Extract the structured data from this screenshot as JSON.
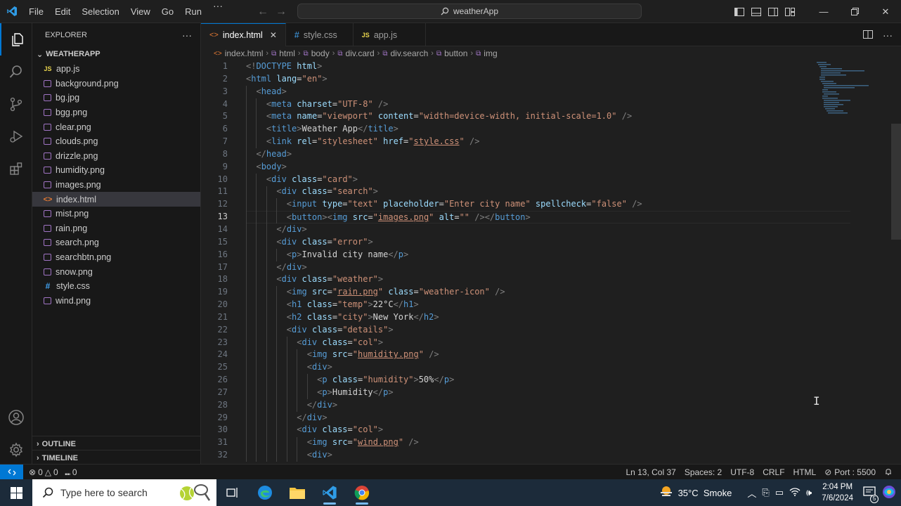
{
  "titlebar": {
    "menu": [
      "File",
      "Edit",
      "Selection",
      "View",
      "Go",
      "Run"
    ],
    "more": "···",
    "command_center": "weatherApp"
  },
  "sidebar": {
    "title": "EXPLORER",
    "more": "···",
    "folder": "WEATHERAPP",
    "files": [
      {
        "name": "app.js",
        "type": "js"
      },
      {
        "name": "background.png",
        "type": "img"
      },
      {
        "name": "bg.jpg",
        "type": "img"
      },
      {
        "name": "bgg.png",
        "type": "img"
      },
      {
        "name": "clear.png",
        "type": "img"
      },
      {
        "name": "clouds.png",
        "type": "img"
      },
      {
        "name": "drizzle.png",
        "type": "img"
      },
      {
        "name": "humidity.png",
        "type": "img"
      },
      {
        "name": "images.png",
        "type": "img"
      },
      {
        "name": "index.html",
        "type": "html",
        "selected": true
      },
      {
        "name": "mist.png",
        "type": "img"
      },
      {
        "name": "rain.png",
        "type": "img"
      },
      {
        "name": "search.png",
        "type": "img"
      },
      {
        "name": "searchbtn.png",
        "type": "img"
      },
      {
        "name": "snow.png",
        "type": "img"
      },
      {
        "name": "style.css",
        "type": "css"
      },
      {
        "name": "wind.png",
        "type": "img"
      }
    ],
    "outline": "OUTLINE",
    "timeline": "TIMELINE"
  },
  "tabs": [
    {
      "label": "index.html",
      "icon": "<>",
      "active": true
    },
    {
      "label": "style.css",
      "icon": "#"
    },
    {
      "label": "app.js",
      "icon": "JS"
    }
  ],
  "breadcrumbs": [
    "index.html",
    "html",
    "body",
    "div.card",
    "div.search",
    "button",
    "img"
  ],
  "editor": {
    "current_line": 13,
    "lines": [
      [
        [
          "t",
          "<!"
        ],
        [
          "tg",
          "DOCTYPE"
        ],
        [
          "tx",
          " "
        ],
        [
          "at",
          "html"
        ],
        [
          "t",
          ">"
        ]
      ],
      [
        [
          "t",
          "<"
        ],
        [
          "tg",
          "html"
        ],
        [
          "tx",
          " "
        ],
        [
          "at",
          "lang"
        ],
        [
          "tx",
          "="
        ],
        [
          "st",
          "\"en\""
        ],
        [
          "t",
          ">"
        ]
      ],
      [
        [
          "tx",
          "  "
        ],
        [
          "t",
          "<"
        ],
        [
          "tg",
          "head"
        ],
        [
          "t",
          ">"
        ]
      ],
      [
        [
          "tx",
          "    "
        ],
        [
          "t",
          "<"
        ],
        [
          "tg",
          "meta"
        ],
        [
          "tx",
          " "
        ],
        [
          "at",
          "charset"
        ],
        [
          "tx",
          "="
        ],
        [
          "st",
          "\"UTF-8\""
        ],
        [
          "tx",
          " "
        ],
        [
          "t",
          "/>"
        ]
      ],
      [
        [
          "tx",
          "    "
        ],
        [
          "t",
          "<"
        ],
        [
          "tg",
          "meta"
        ],
        [
          "tx",
          " "
        ],
        [
          "at",
          "name"
        ],
        [
          "tx",
          "="
        ],
        [
          "st",
          "\"viewport\""
        ],
        [
          "tx",
          " "
        ],
        [
          "at",
          "content"
        ],
        [
          "tx",
          "="
        ],
        [
          "st",
          "\"width=device-width, initial-scale=1.0\""
        ],
        [
          "tx",
          " "
        ],
        [
          "t",
          "/>"
        ]
      ],
      [
        [
          "tx",
          "    "
        ],
        [
          "t",
          "<"
        ],
        [
          "tg",
          "title"
        ],
        [
          "t",
          ">"
        ],
        [
          "tx",
          "Weather App"
        ],
        [
          "t",
          "</"
        ],
        [
          "tg",
          "title"
        ],
        [
          "t",
          ">"
        ]
      ],
      [
        [
          "tx",
          "    "
        ],
        [
          "t",
          "<"
        ],
        [
          "tg",
          "link"
        ],
        [
          "tx",
          " "
        ],
        [
          "at",
          "rel"
        ],
        [
          "tx",
          "="
        ],
        [
          "st",
          "\"stylesheet\""
        ],
        [
          "tx",
          " "
        ],
        [
          "at",
          "href"
        ],
        [
          "tx",
          "="
        ],
        [
          "st",
          "\""
        ],
        [
          "stu",
          "style.css"
        ],
        [
          "st",
          "\""
        ],
        [
          "tx",
          " "
        ],
        [
          "t",
          "/>"
        ]
      ],
      [
        [
          "tx",
          "  "
        ],
        [
          "t",
          "</"
        ],
        [
          "tg",
          "head"
        ],
        [
          "t",
          ">"
        ]
      ],
      [
        [
          "tx",
          "  "
        ],
        [
          "t",
          "<"
        ],
        [
          "tg",
          "body"
        ],
        [
          "t",
          ">"
        ]
      ],
      [
        [
          "tx",
          "    "
        ],
        [
          "t",
          "<"
        ],
        [
          "tg",
          "div"
        ],
        [
          "tx",
          " "
        ],
        [
          "at",
          "class"
        ],
        [
          "tx",
          "="
        ],
        [
          "st",
          "\"card\""
        ],
        [
          "t",
          ">"
        ]
      ],
      [
        [
          "tx",
          "      "
        ],
        [
          "t",
          "<"
        ],
        [
          "tg",
          "div"
        ],
        [
          "tx",
          " "
        ],
        [
          "at",
          "class"
        ],
        [
          "tx",
          "="
        ],
        [
          "st",
          "\"search\""
        ],
        [
          "t",
          ">"
        ]
      ],
      [
        [
          "tx",
          "        "
        ],
        [
          "t",
          "<"
        ],
        [
          "tg",
          "input"
        ],
        [
          "tx",
          " "
        ],
        [
          "at",
          "type"
        ],
        [
          "tx",
          "="
        ],
        [
          "st",
          "\"text\""
        ],
        [
          "tx",
          " "
        ],
        [
          "at",
          "placeholder"
        ],
        [
          "tx",
          "="
        ],
        [
          "st",
          "\"Enter city name\""
        ],
        [
          "tx",
          " "
        ],
        [
          "at",
          "spellcheck"
        ],
        [
          "tx",
          "="
        ],
        [
          "st",
          "\"false\""
        ],
        [
          "tx",
          " "
        ],
        [
          "t",
          "/>"
        ]
      ],
      [
        [
          "tx",
          "        "
        ],
        [
          "t",
          "<"
        ],
        [
          "tg",
          "button"
        ],
        [
          "t",
          "><"
        ],
        [
          "tg",
          "img"
        ],
        [
          "tx",
          " "
        ],
        [
          "at",
          "src"
        ],
        [
          "tx",
          "="
        ],
        [
          "st",
          "\""
        ],
        [
          "stu",
          "images.png"
        ],
        [
          "st",
          "\""
        ],
        [
          "tx",
          " "
        ],
        [
          "at",
          "alt"
        ],
        [
          "tx",
          "="
        ],
        [
          "st",
          "\"\""
        ],
        [
          "tx",
          " "
        ],
        [
          "t",
          "/></"
        ],
        [
          "tg",
          "button"
        ],
        [
          "t",
          ">"
        ]
      ],
      [
        [
          "tx",
          "      "
        ],
        [
          "t",
          "</"
        ],
        [
          "tg",
          "div"
        ],
        [
          "t",
          ">"
        ]
      ],
      [
        [
          "tx",
          "      "
        ],
        [
          "t",
          "<"
        ],
        [
          "tg",
          "div"
        ],
        [
          "tx",
          " "
        ],
        [
          "at",
          "class"
        ],
        [
          "tx",
          "="
        ],
        [
          "st",
          "\"error\""
        ],
        [
          "t",
          ">"
        ]
      ],
      [
        [
          "tx",
          "        "
        ],
        [
          "t",
          "<"
        ],
        [
          "tg",
          "p"
        ],
        [
          "t",
          ">"
        ],
        [
          "tx",
          "Invalid city name"
        ],
        [
          "t",
          "</"
        ],
        [
          "tg",
          "p"
        ],
        [
          "t",
          ">"
        ]
      ],
      [
        [
          "tx",
          "      "
        ],
        [
          "t",
          "</"
        ],
        [
          "tg",
          "div"
        ],
        [
          "t",
          ">"
        ]
      ],
      [
        [
          "tx",
          "      "
        ],
        [
          "t",
          "<"
        ],
        [
          "tg",
          "div"
        ],
        [
          "tx",
          " "
        ],
        [
          "at",
          "class"
        ],
        [
          "tx",
          "="
        ],
        [
          "st",
          "\"weather\""
        ],
        [
          "t",
          ">"
        ]
      ],
      [
        [
          "tx",
          "        "
        ],
        [
          "t",
          "<"
        ],
        [
          "tg",
          "img"
        ],
        [
          "tx",
          " "
        ],
        [
          "at",
          "src"
        ],
        [
          "tx",
          "="
        ],
        [
          "st",
          "\""
        ],
        [
          "stu",
          "rain.png"
        ],
        [
          "st",
          "\""
        ],
        [
          "tx",
          " "
        ],
        [
          "at",
          "class"
        ],
        [
          "tx",
          "="
        ],
        [
          "st",
          "\"weather-icon\""
        ],
        [
          "tx",
          " "
        ],
        [
          "t",
          "/>"
        ]
      ],
      [
        [
          "tx",
          "        "
        ],
        [
          "t",
          "<"
        ],
        [
          "tg",
          "h1"
        ],
        [
          "tx",
          " "
        ],
        [
          "at",
          "class"
        ],
        [
          "tx",
          "="
        ],
        [
          "st",
          "\"temp\""
        ],
        [
          "t",
          ">"
        ],
        [
          "tx",
          "22°C"
        ],
        [
          "t",
          "</"
        ],
        [
          "tg",
          "h1"
        ],
        [
          "t",
          ">"
        ]
      ],
      [
        [
          "tx",
          "        "
        ],
        [
          "t",
          "<"
        ],
        [
          "tg",
          "h2"
        ],
        [
          "tx",
          " "
        ],
        [
          "at",
          "class"
        ],
        [
          "tx",
          "="
        ],
        [
          "st",
          "\"city\""
        ],
        [
          "t",
          ">"
        ],
        [
          "tx",
          "New York"
        ],
        [
          "t",
          "</"
        ],
        [
          "tg",
          "h2"
        ],
        [
          "t",
          ">"
        ]
      ],
      [
        [
          "tx",
          "        "
        ],
        [
          "t",
          "<"
        ],
        [
          "tg",
          "div"
        ],
        [
          "tx",
          " "
        ],
        [
          "at",
          "class"
        ],
        [
          "tx",
          "="
        ],
        [
          "st",
          "\"details\""
        ],
        [
          "t",
          ">"
        ]
      ],
      [
        [
          "tx",
          "          "
        ],
        [
          "t",
          "<"
        ],
        [
          "tg",
          "div"
        ],
        [
          "tx",
          " "
        ],
        [
          "at",
          "class"
        ],
        [
          "tx",
          "="
        ],
        [
          "st",
          "\"col\""
        ],
        [
          "t",
          ">"
        ]
      ],
      [
        [
          "tx",
          "            "
        ],
        [
          "t",
          "<"
        ],
        [
          "tg",
          "img"
        ],
        [
          "tx",
          " "
        ],
        [
          "at",
          "src"
        ],
        [
          "tx",
          "="
        ],
        [
          "st",
          "\""
        ],
        [
          "stu",
          "humidity.png"
        ],
        [
          "st",
          "\""
        ],
        [
          "tx",
          " "
        ],
        [
          "t",
          "/>"
        ]
      ],
      [
        [
          "tx",
          "            "
        ],
        [
          "t",
          "<"
        ],
        [
          "tg",
          "div"
        ],
        [
          "t",
          ">"
        ]
      ],
      [
        [
          "tx",
          "              "
        ],
        [
          "t",
          "<"
        ],
        [
          "tg",
          "p"
        ],
        [
          "tx",
          " "
        ],
        [
          "at",
          "class"
        ],
        [
          "tx",
          "="
        ],
        [
          "st",
          "\"humidity\""
        ],
        [
          "t",
          ">"
        ],
        [
          "tx",
          "50%"
        ],
        [
          "t",
          "</"
        ],
        [
          "tg",
          "p"
        ],
        [
          "t",
          ">"
        ]
      ],
      [
        [
          "tx",
          "              "
        ],
        [
          "t",
          "<"
        ],
        [
          "tg",
          "p"
        ],
        [
          "t",
          ">"
        ],
        [
          "tx",
          "Humidity"
        ],
        [
          "t",
          "</"
        ],
        [
          "tg",
          "p"
        ],
        [
          "t",
          ">"
        ]
      ],
      [
        [
          "tx",
          "            "
        ],
        [
          "t",
          "</"
        ],
        [
          "tg",
          "div"
        ],
        [
          "t",
          ">"
        ]
      ],
      [
        [
          "tx",
          "          "
        ],
        [
          "t",
          "</"
        ],
        [
          "tg",
          "div"
        ],
        [
          "t",
          ">"
        ]
      ],
      [
        [
          "tx",
          "          "
        ],
        [
          "t",
          "<"
        ],
        [
          "tg",
          "div"
        ],
        [
          "tx",
          " "
        ],
        [
          "at",
          "class"
        ],
        [
          "tx",
          "="
        ],
        [
          "st",
          "\"col\""
        ],
        [
          "t",
          ">"
        ]
      ],
      [
        [
          "tx",
          "            "
        ],
        [
          "t",
          "<"
        ],
        [
          "tg",
          "img"
        ],
        [
          "tx",
          " "
        ],
        [
          "at",
          "src"
        ],
        [
          "tx",
          "="
        ],
        [
          "st",
          "\""
        ],
        [
          "stu",
          "wind.png"
        ],
        [
          "st",
          "\""
        ],
        [
          "tx",
          " "
        ],
        [
          "t",
          "/>"
        ]
      ],
      [
        [
          "tx",
          "            "
        ],
        [
          "t",
          "<"
        ],
        [
          "tg",
          "div"
        ],
        [
          "t",
          ">"
        ]
      ]
    ]
  },
  "statusbar": {
    "errors": "0",
    "warnings": "0",
    "ports_count": "0",
    "position": "Ln 13, Col 37",
    "spaces": "Spaces: 2",
    "encoding": "UTF-8",
    "eol": "CRLF",
    "language": "HTML",
    "port": "Port : 5500"
  },
  "taskbar": {
    "search_placeholder": "Type here to search",
    "weather": "35°C  Smoke",
    "time": "2:04 PM",
    "date": "7/6/2024",
    "notification_count": "5"
  }
}
